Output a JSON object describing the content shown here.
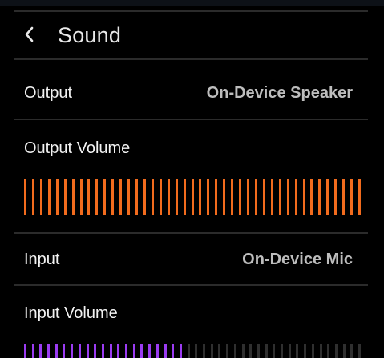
{
  "header": {
    "title": "Sound",
    "back_icon": "chevron-left-icon"
  },
  "output": {
    "label": "Output",
    "value": "On-Device Speaker"
  },
  "output_volume": {
    "label": "Output Volume",
    "level": 1.0,
    "ticks": 43,
    "active_color": "#f26b1d",
    "inactive_color": "#2f2f2f"
  },
  "input": {
    "label": "Input",
    "value": "On-Device Mic"
  },
  "input_volume": {
    "label": "Input Volume",
    "level": 0.48,
    "ticks": 44,
    "active_color": "#9b3cf2",
    "inactive_color": "#2f2f2f"
  },
  "colors": {
    "background": "#000000",
    "divider": "#2b2b2b",
    "value_text": "#bdbdbd"
  }
}
